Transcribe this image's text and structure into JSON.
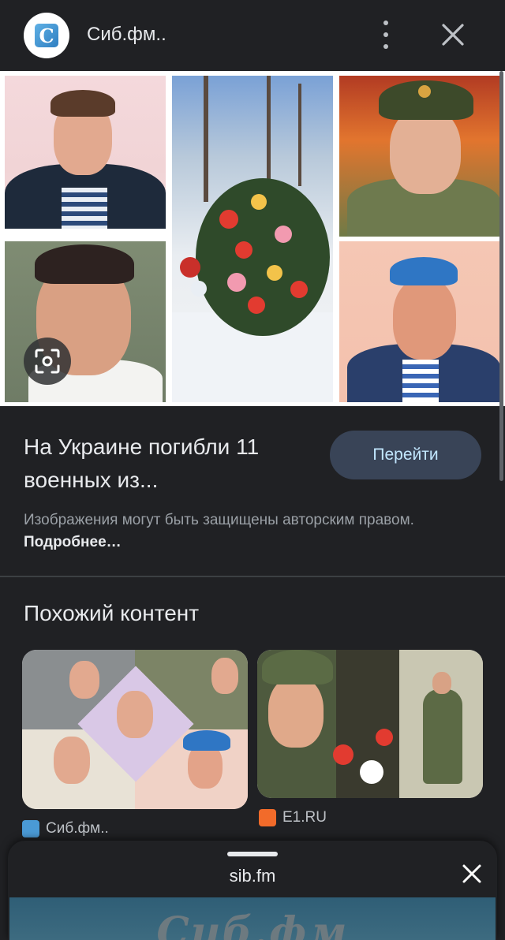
{
  "header": {
    "site_icon_letter": "С",
    "site_name": "Сиб.фм..",
    "more_icon": "more-vert-icon",
    "close_icon": "close-icon"
  },
  "main": {
    "title": "На Украине погибли 11 военных из...",
    "go_button": "Перейти",
    "copyright_text": "Изображения могут быть защищены авторским правом.",
    "learn_more_link": "Подробнее…",
    "lens_icon": "lens-search-icon"
  },
  "similar": {
    "title": "Похожий контент",
    "cards": [
      {
        "source": "Сиб.фм..",
        "source_icon_color": "#4a9ad6"
      },
      {
        "source": "E1.RU",
        "source_icon_color": "#f26b2a"
      }
    ]
  },
  "sheet": {
    "domain": "sib.fm",
    "preview_brand": "Сиб.фм",
    "close_icon": "close-icon"
  },
  "colors": {
    "background": "#202124",
    "button_bg": "#394457",
    "button_text": "#c2e7ff"
  }
}
